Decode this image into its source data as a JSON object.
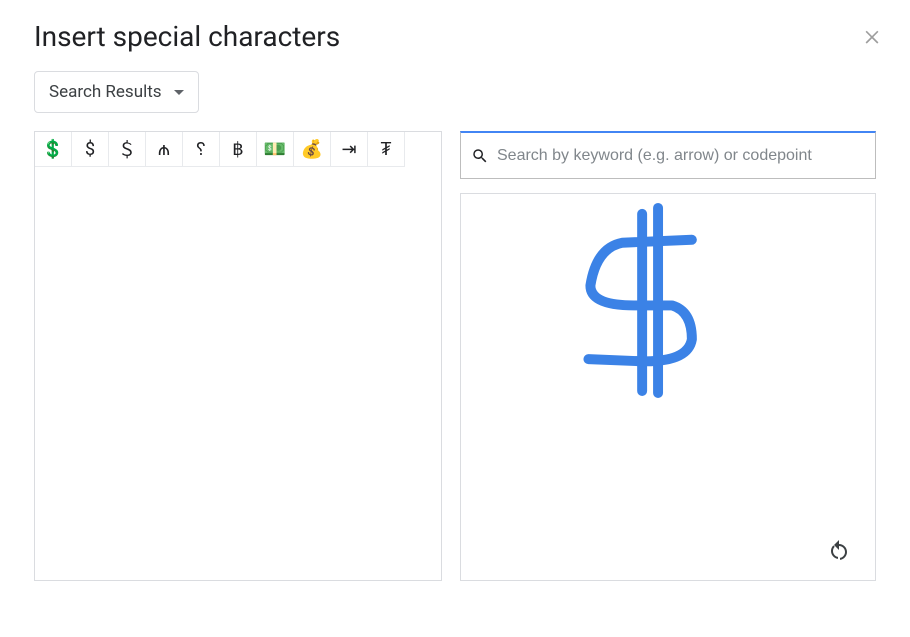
{
  "dialog": {
    "title": "Insert special characters"
  },
  "filter": {
    "dropdown_label": "Search Results"
  },
  "search": {
    "placeholder": "Search by keyword (e.g. arrow) or codepoint",
    "value": ""
  },
  "results": {
    "chars": [
      "💲",
      "$",
      "＄",
      "₼",
      "␦",
      "฿",
      "💵",
      "💰",
      "⇥",
      "₮"
    ]
  },
  "icons": {
    "close": "close-icon",
    "search": "search-icon",
    "undo": "undo-icon",
    "dropdown_arrow": "chevron-down-icon"
  }
}
